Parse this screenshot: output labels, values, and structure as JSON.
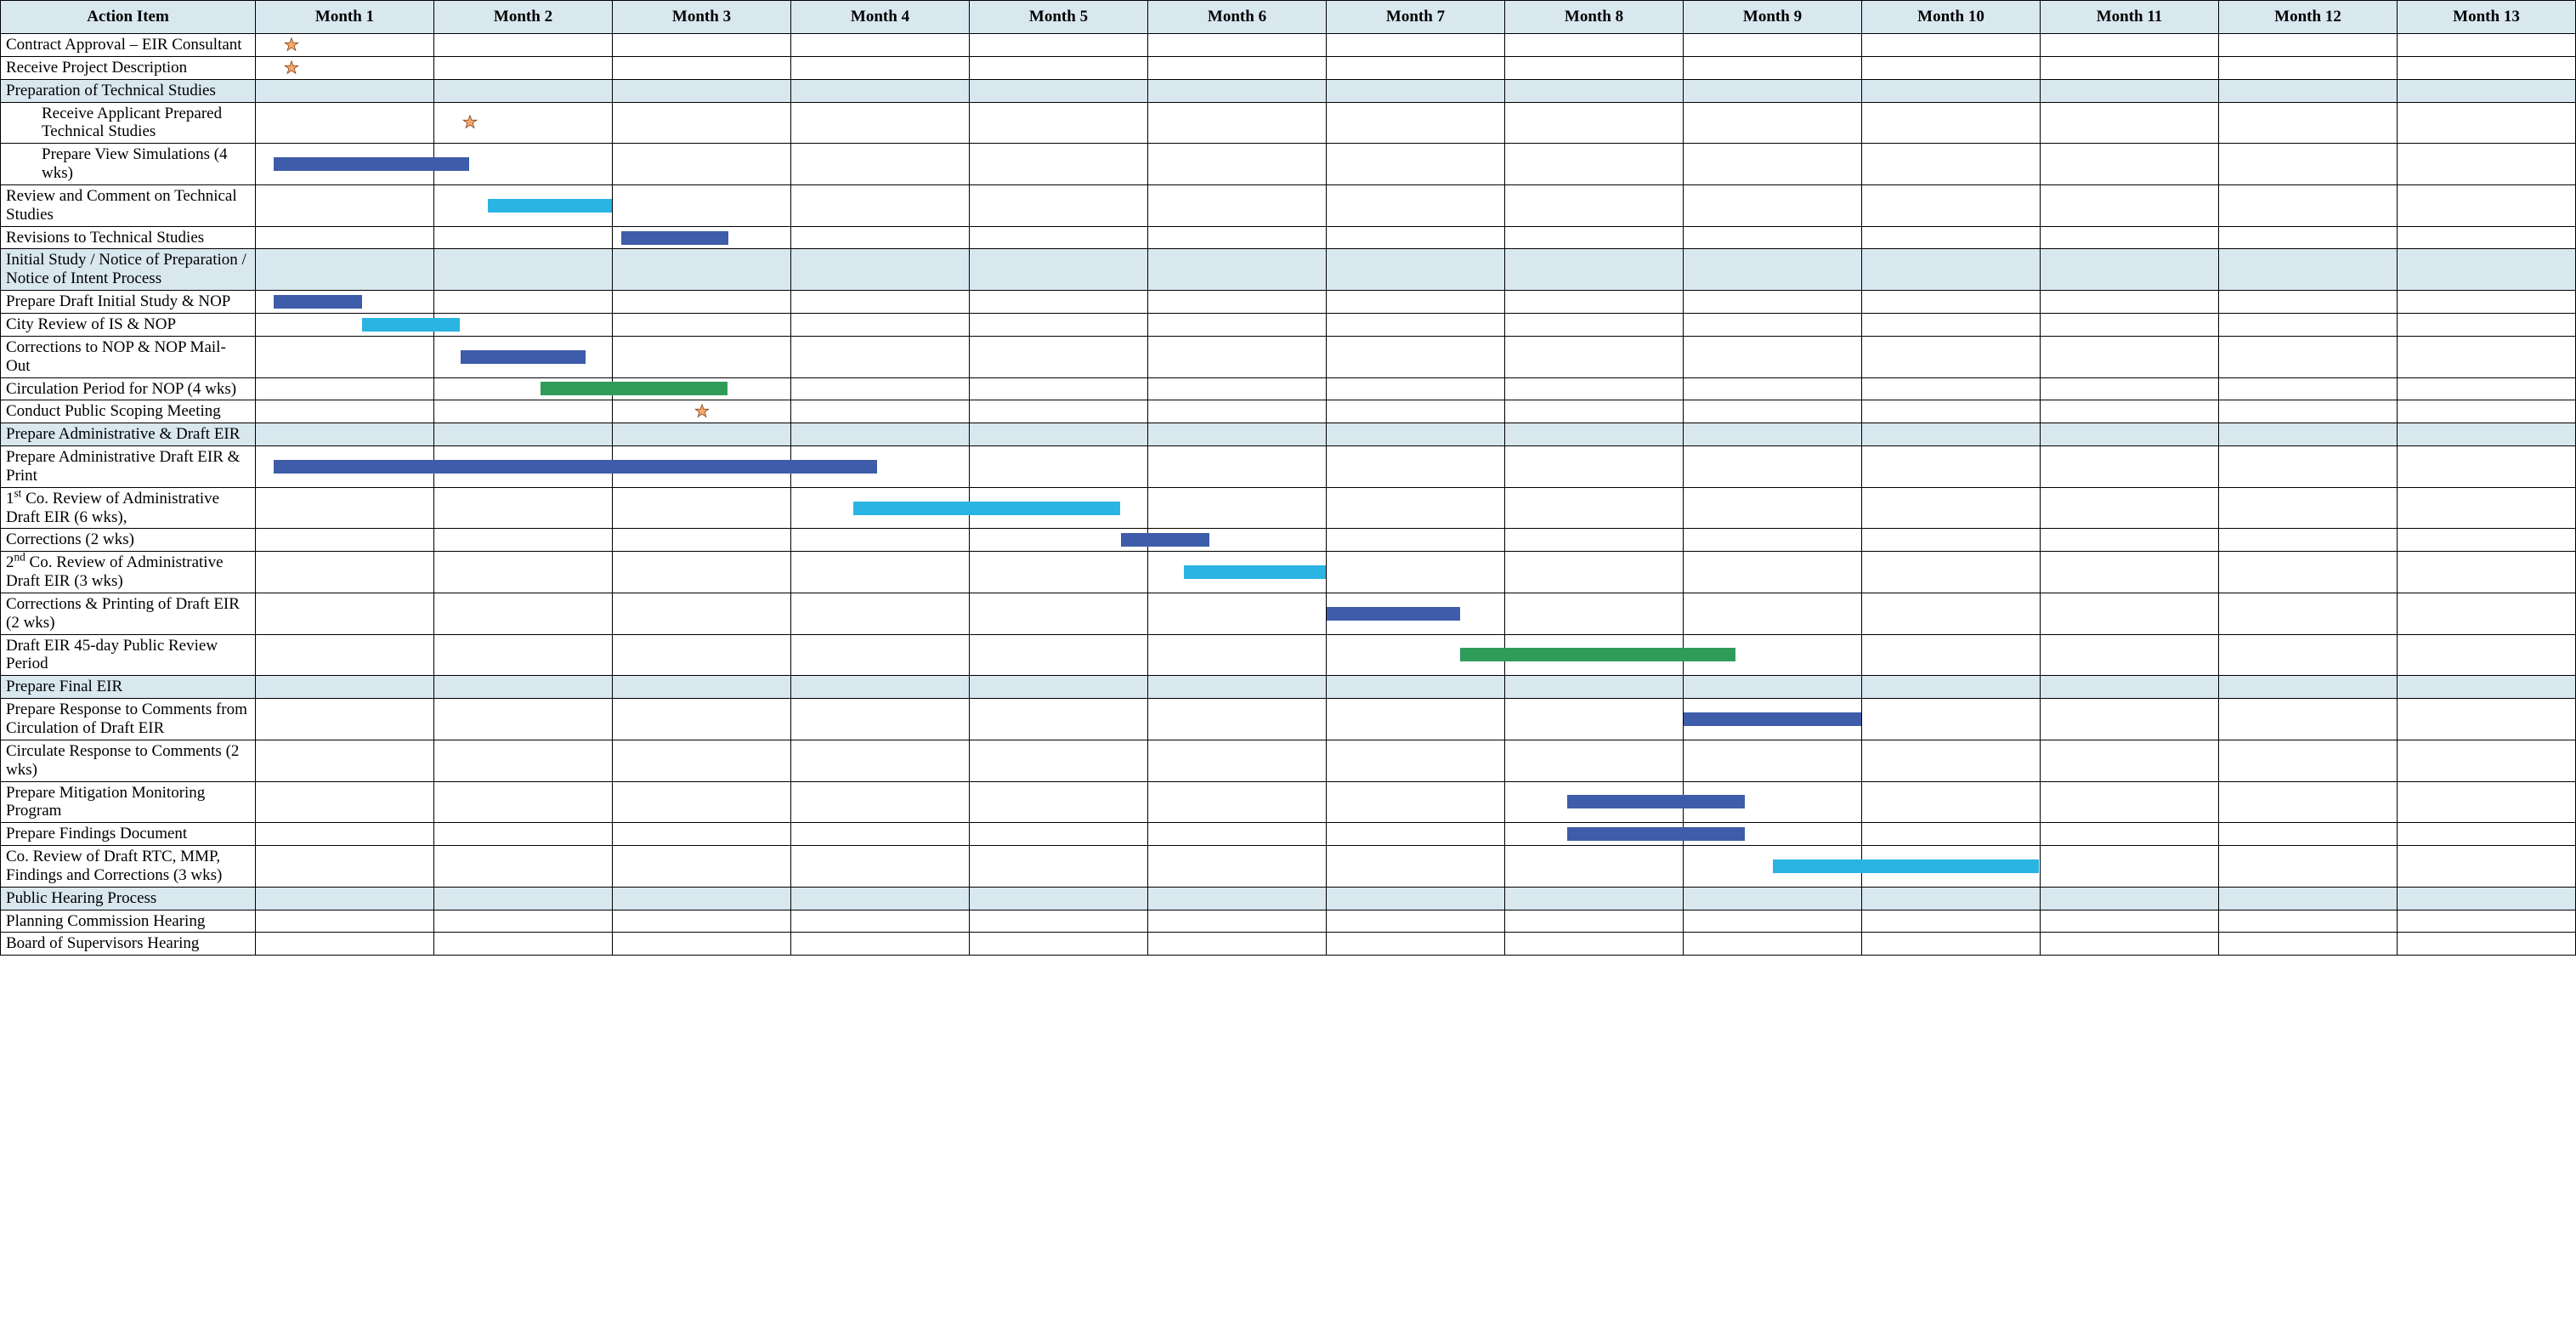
{
  "chart_data": {
    "type": "bar",
    "title": "",
    "xlabel": "",
    "ylabel": "Action Item",
    "months": 13,
    "categories": [
      "Month 1",
      "Month 2",
      "Month 3",
      "Month 4",
      "Month 5",
      "Month 6",
      "Month 7",
      "Month 8",
      "Month 9",
      "Month 10",
      "Month 11",
      "Month 12",
      "Month 13"
    ],
    "colors": {
      "darkblue": "#3f5caa",
      "lightblue": "#29b4e3",
      "green": "#2f9c5a",
      "section": "#d9e7ef"
    },
    "rows": [
      {
        "label": "Contract Approval – EIR Consultant",
        "stars": [
          {
            "month": 1,
            "pos": 0.2
          }
        ]
      },
      {
        "label": "Receive Project Description",
        "stars": [
          {
            "month": 1,
            "pos": 0.2
          }
        ]
      },
      {
        "label": "Preparation of Technical Studies",
        "section": true
      },
      {
        "label": "Receive Applicant Prepared Technical Studies",
        "indent": true,
        "tall": true,
        "stars": [
          {
            "month": 2,
            "pos": 0.2
          }
        ]
      },
      {
        "label": "Prepare View Simulations (4 wks)",
        "indent": true,
        "bars": [
          {
            "start": 1.1,
            "end": 2.2,
            "color": "darkblue"
          }
        ]
      },
      {
        "label": "Review and Comment on Technical Studies",
        "tall": true,
        "bars": [
          {
            "start": 2.3,
            "end": 3.0,
            "color": "lightblue"
          }
        ]
      },
      {
        "label": "Revisions to Technical Studies",
        "bars": [
          {
            "start": 3.05,
            "end": 3.65,
            "color": "darkblue"
          }
        ]
      },
      {
        "label": "Initial Study / Notice of Preparation / Notice of Intent Process",
        "section": true,
        "tall": true
      },
      {
        "label": "Prepare Draft Initial Study & NOP",
        "bars": [
          {
            "start": 1.1,
            "end": 1.6,
            "color": "darkblue"
          }
        ]
      },
      {
        "label": "City Review of IS & NOP",
        "bars": [
          {
            "start": 1.6,
            "end": 2.15,
            "color": "lightblue"
          }
        ]
      },
      {
        "label": "Corrections to NOP & NOP Mail-Out",
        "bars": [
          {
            "start": 2.15,
            "end": 2.85,
            "color": "darkblue"
          }
        ]
      },
      {
        "label": "Circulation Period for NOP  (4 wks)",
        "bars": [
          {
            "start": 2.6,
            "end": 3.65,
            "color": "green"
          }
        ]
      },
      {
        "label": "Conduct Public Scoping Meeting",
        "stars": [
          {
            "month": 3,
            "pos": 0.5
          }
        ]
      },
      {
        "label": "Prepare Administrative & Draft EIR",
        "section": true
      },
      {
        "label": "Prepare Administrative Draft EIR & Print",
        "bars": [
          {
            "start": 1.1,
            "end": 4.5,
            "color": "darkblue"
          }
        ]
      },
      {
        "label_html": "1<span class='sup'>st</span> Co. Review of Administrative Draft EIR (6 wks),",
        "tall": true,
        "bars": [
          {
            "start": 4.35,
            "end": 5.85,
            "color": "lightblue"
          }
        ]
      },
      {
        "label": "Corrections (2 wks)",
        "bars": [
          {
            "start": 5.85,
            "end": 6.35,
            "color": "darkblue"
          }
        ]
      },
      {
        "label_html": "2<span class='sup'>nd</span> Co. Review of Administrative Draft EIR (3 wks)",
        "tall": true,
        "bars": [
          {
            "start": 6.2,
            "end": 7.0,
            "color": "lightblue"
          }
        ]
      },
      {
        "label": "Corrections & Printing of Draft EIR (2 wks)",
        "tall": true,
        "bars": [
          {
            "start": 7.0,
            "end": 7.75,
            "color": "darkblue"
          }
        ]
      },
      {
        "label": "Draft EIR 45-day Public Review Period",
        "bars": [
          {
            "start": 7.75,
            "end": 9.3,
            "color": "green"
          }
        ]
      },
      {
        "label": "Prepare Final EIR",
        "section": true
      },
      {
        "label": "Prepare Response to Comments from Circulation of Draft EIR",
        "tall": true,
        "bars": [
          {
            "start": 9.0,
            "end": 10.0,
            "color": "darkblue"
          }
        ]
      },
      {
        "label": "Circulate Response to Comments (2 wks)"
      },
      {
        "label": "Prepare Mitigation Monitoring Program",
        "bars": [
          {
            "start": 8.35,
            "end": 9.35,
            "color": "darkblue"
          }
        ]
      },
      {
        "label": "Prepare Findings Document",
        "bars": [
          {
            "start": 8.35,
            "end": 9.35,
            "color": "darkblue"
          }
        ]
      },
      {
        "label": "Co. Review of Draft RTC, MMP, Findings and Corrections (3 wks)",
        "tall": true,
        "bars": [
          {
            "start": 9.5,
            "end": 11.0,
            "color": "lightblue"
          }
        ]
      },
      {
        "label": "Public Hearing Process",
        "section": true
      },
      {
        "label": "Planning Commission Hearing"
      },
      {
        "label": "Board of Supervisors Hearing"
      }
    ]
  },
  "headers": {
    "action": "Action Item",
    "months": [
      "Month 1",
      "Month 2",
      "Month 3",
      "Month 4",
      "Month 5",
      "Month 6",
      "Month 7",
      "Month 8",
      "Month 9",
      "Month 10",
      "Month 11",
      "Month 12",
      "Month 13"
    ]
  }
}
